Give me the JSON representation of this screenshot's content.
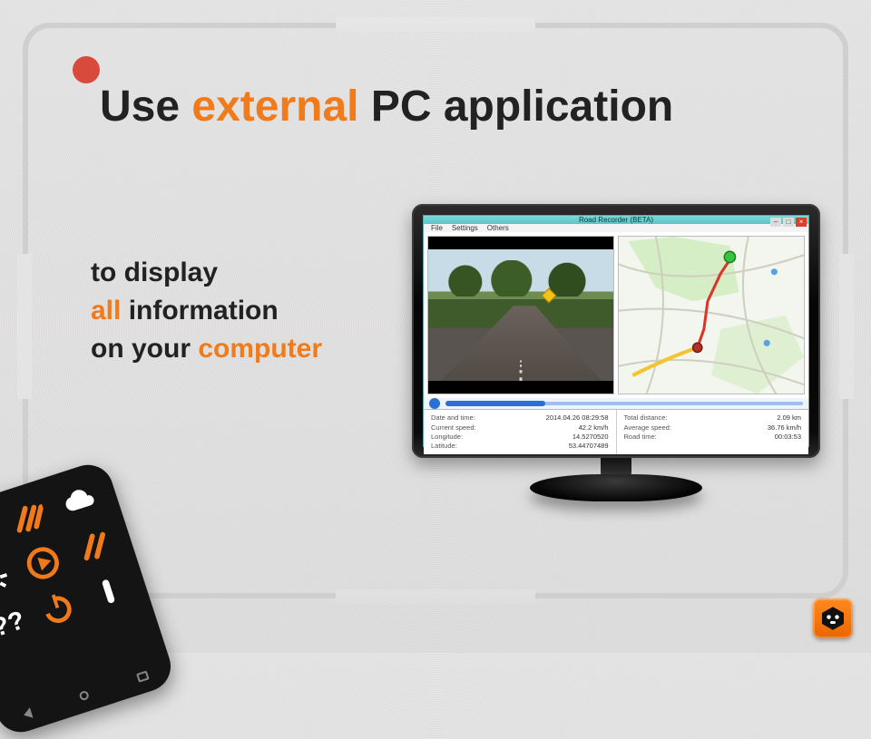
{
  "title": {
    "pre": "Use ",
    "hl": "external",
    "post": " PC application"
  },
  "body": {
    "l1": "to display",
    "l2_hl": "all",
    "l2_rest": " information",
    "l3_pre": "on your ",
    "l3_hl": "computer"
  },
  "app": {
    "window_title": "Road Recorder (BETA)",
    "menu": [
      "File",
      "Settings",
      "Others"
    ],
    "winbtn": {
      "min": "–",
      "max": "□",
      "close": "×"
    },
    "stats_left": [
      {
        "label": "Date and time:",
        "value": "2014.04.26 08:29:58"
      },
      {
        "label": "Current speed:",
        "value": "42.2 km/h"
      },
      {
        "label": "Longitude:",
        "value": "14.5270520"
      },
      {
        "label": "Latitude:",
        "value": "53.44707489"
      }
    ],
    "stats_right": [
      {
        "label": "Total distance:",
        "value": "2.09 km"
      },
      {
        "label": "Average speed:",
        "value": "36.76 km/h"
      },
      {
        "label": "Road time:",
        "value": "00:03:53"
      }
    ]
  },
  "colors": {
    "accent": "#f17a1a"
  }
}
